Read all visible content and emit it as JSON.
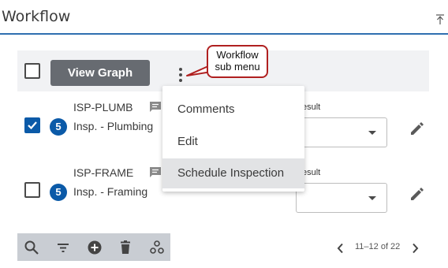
{
  "header": {
    "title": "Workflow",
    "collapse_icon": "collapse-up-icon"
  },
  "toolbar_top": {
    "view_graph_label": "View Graph",
    "more_icon": "more-vert-icon"
  },
  "callout": {
    "line1": "Workflow",
    "line2": "sub menu"
  },
  "rows": [
    {
      "checked": true,
      "badge": "5",
      "code": "ISP-PLUMB",
      "description": "Insp. - Plumbing",
      "result_label": "esult",
      "result_value": ""
    },
    {
      "checked": false,
      "badge": "5",
      "code": "ISP-FRAME",
      "description": "Insp. - Framing",
      "result_label": "esult",
      "result_value": ""
    }
  ],
  "menu": {
    "items": [
      "Comments",
      "Edit",
      "Schedule Inspection"
    ],
    "highlighted_index": 2
  },
  "bottom_toolbar": {
    "icons": [
      "search-icon",
      "filter-icon",
      "add-circle-icon",
      "delete-icon",
      "workflow-icon"
    ]
  },
  "pager": {
    "text": "11–12 of 22"
  },
  "colors": {
    "accent": "#0b5aa8",
    "header_rule": "#2f6fb0",
    "callout_border": "#b02020"
  }
}
